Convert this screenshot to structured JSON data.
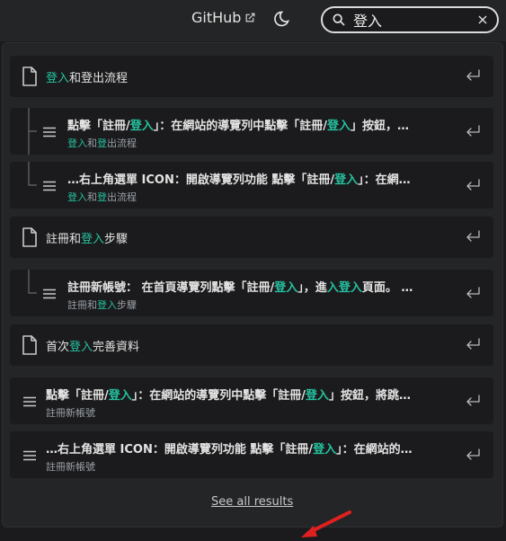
{
  "navbar": {
    "github_label": "GitHub",
    "search_value": "登入"
  },
  "results": [
    {
      "kind": "page",
      "title_parts": [
        {
          "t": "登入",
          "h": true
        },
        {
          "t": "和登出流程",
          "h": false
        }
      ]
    },
    {
      "kind": "section",
      "tree": "mid",
      "title_parts": [
        {
          "t": "點擊「註冊/",
          "h": false
        },
        {
          "t": "登入",
          "h": true
        },
        {
          "t": "」：在網站的導覽列中點擊「註冊/",
          "h": false
        },
        {
          "t": "登入",
          "h": true
        },
        {
          "t": "」按鈕，…",
          "h": false
        }
      ],
      "sub_parts": [
        {
          "t": "登入",
          "h": true
        },
        {
          "t": "和",
          "h": false
        },
        {
          "t": "登",
          "h": true
        },
        {
          "t": "出流程",
          "h": false
        }
      ]
    },
    {
      "kind": "section",
      "tree": "end",
      "title_parts": [
        {
          "t": "…右上角選單 ICON：開啟導覽列功能 點擊「註冊/",
          "h": false
        },
        {
          "t": "登入",
          "h": true
        },
        {
          "t": "」：在網…",
          "h": false
        }
      ],
      "sub_parts": [
        {
          "t": "登入",
          "h": true
        },
        {
          "t": "和",
          "h": false
        },
        {
          "t": "登",
          "h": true
        },
        {
          "t": "出流程",
          "h": false
        }
      ]
    },
    {
      "kind": "page",
      "title_parts": [
        {
          "t": "註冊和",
          "h": false
        },
        {
          "t": "登入",
          "h": true
        },
        {
          "t": "步驟",
          "h": false
        }
      ]
    },
    {
      "kind": "section",
      "tree": "end",
      "title_parts": [
        {
          "t": "註冊新帳號： 在首頁導覽列點擊「註冊/",
          "h": false
        },
        {
          "t": "登入",
          "h": true
        },
        {
          "t": "」，進",
          "h": false
        },
        {
          "t": "入登入",
          "h": true
        },
        {
          "t": "頁面。 …",
          "h": false
        }
      ],
      "sub_parts": [
        {
          "t": "註冊和",
          "h": false
        },
        {
          "t": "登入",
          "h": true
        },
        {
          "t": "步驟",
          "h": false
        }
      ]
    },
    {
      "kind": "page",
      "title_parts": [
        {
          "t": "首次",
          "h": false
        },
        {
          "t": "登入",
          "h": true
        },
        {
          "t": "完善資料",
          "h": false
        }
      ]
    },
    {
      "kind": "section",
      "tree": "none",
      "title_parts": [
        {
          "t": "點擊「註冊/",
          "h": false
        },
        {
          "t": "登入",
          "h": true
        },
        {
          "t": "」：在網站的導覽列中點擊「註冊/",
          "h": false
        },
        {
          "t": "登入",
          "h": true
        },
        {
          "t": "」按鈕，將跳…",
          "h": false
        }
      ],
      "sub_parts": [
        {
          "t": "註冊新帳號",
          "h": false
        }
      ]
    },
    {
      "kind": "section",
      "tree": "none",
      "title_parts": [
        {
          "t": "…右上角選單 ICON：開啟導覽列功能 點擊「註冊/",
          "h": false
        },
        {
          "t": "登入",
          "h": true
        },
        {
          "t": "」：在網站的…",
          "h": false
        }
      ],
      "sub_parts": [
        {
          "t": "註冊新帳號",
          "h": false
        }
      ]
    }
  ],
  "footer": {
    "see_all_label": "See all results"
  },
  "colors": {
    "highlight": "#25c2a0",
    "annotation_arrow": "#e02020"
  }
}
